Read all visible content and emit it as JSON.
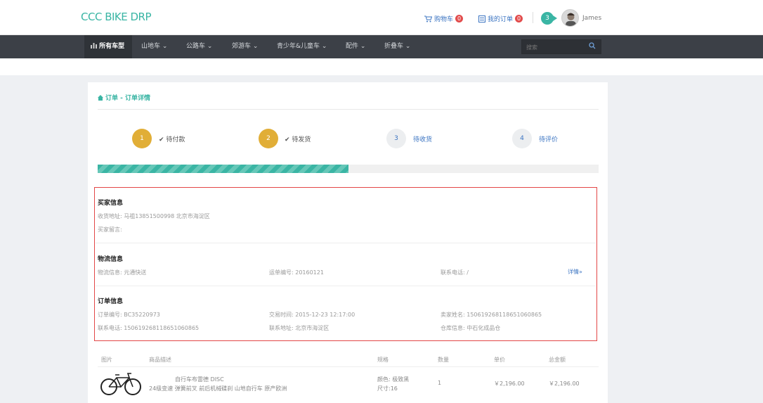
{
  "header": {
    "logo": "CCC BIKE DRP",
    "cart_label": "购物车",
    "cart_count": "0",
    "orders_label": "我的订单",
    "orders_count": "0",
    "notification_count": "3",
    "user_name": "James"
  },
  "nav": {
    "items": [
      "所有车型",
      "山地车",
      "公路车",
      "郊游车",
      "青少年&儿童车",
      "配件",
      "折叠车"
    ],
    "search_placeholder": "搜索"
  },
  "breadcrumb": "订单 - 订单详情",
  "steps": [
    {
      "num": "1",
      "label": "待付款",
      "done": true
    },
    {
      "num": "2",
      "label": "待发货",
      "done": true
    },
    {
      "num": "3",
      "label": "待收货",
      "done": false
    },
    {
      "num": "4",
      "label": "待评价",
      "done": false
    }
  ],
  "progress_fraction": 0.5,
  "buyer": {
    "title": "买家信息",
    "address": "收货地址:  马祖13851500998  北京市海淀区",
    "message": "买家留言:"
  },
  "logistics": {
    "title": "物流信息",
    "carrier": "物流信息: 元通快送",
    "waybill": "运单编号: 20160121",
    "phone": "联系电话: /",
    "details_link": "详情"
  },
  "order": {
    "title": "订单信息",
    "order_no": "订单编号: BC35220973",
    "trade_time": "交易时间: 2015-12-23 12:17:00",
    "seller": "卖家姓名: 150619268118651060865",
    "contact_phone": "联系电话: 150619268118651060865",
    "contact_addr": "联系地址: 北京市海淀区",
    "warehouse": "仓库信息: 中石化成品仓"
  },
  "table": {
    "headers": [
      "图片",
      "商品描述",
      "规格",
      "数量",
      "单价",
      "总金额"
    ],
    "rows": [
      {
        "desc_line1": "自行车布雷德 DISC",
        "desc_line2": "24级变速 弹簧前叉 前后机械碟刹 山地自行车 原产欧洲",
        "spec_color": "颜色: 极致黑",
        "spec_size": "尺寸:16",
        "qty": "1",
        "unit_price": "￥2,196.00",
        "total": "￥2,196.00"
      }
    ]
  },
  "colors": {
    "accent": "#3ab5a4",
    "link": "#3b74c2",
    "step_done": "#e1ae37",
    "nav_bg": "#3c4047",
    "highlight_border": "#e34646"
  }
}
